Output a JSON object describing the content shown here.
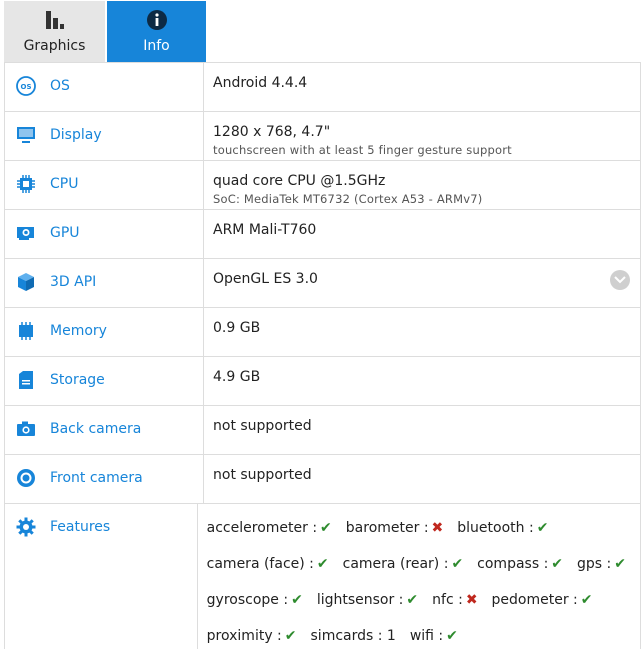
{
  "tabs": [
    {
      "label": "Graphics",
      "icon": "bar-chart-icon",
      "active": false
    },
    {
      "label": "Info",
      "icon": "info-icon",
      "active": true
    }
  ],
  "colors": {
    "accent": "#1785d9",
    "ok": "#2e8b2e",
    "fail": "#c0281e",
    "tab_inactive_bg": "#e6e6e6"
  },
  "rows": [
    {
      "label": "OS",
      "icon": "os-icon",
      "value": "Android 4.4.4",
      "sub": ""
    },
    {
      "label": "Display",
      "icon": "monitor-icon",
      "value": "1280 x 768, 4.7\"",
      "sub": "touchscreen with at least 5 finger gesture support"
    },
    {
      "label": "CPU",
      "icon": "cpu-chip-icon",
      "value": "quad core CPU @1.5GHz",
      "sub": "SoC: MediaTek MT6732 (Cortex A53 - ARMv7)"
    },
    {
      "label": "GPU",
      "icon": "gpu-card-icon",
      "value": "ARM Mali-T760",
      "sub": ""
    },
    {
      "label": "3D API",
      "icon": "cube-icon",
      "value": "OpenGL ES 3.0",
      "sub": "",
      "expandable": true
    },
    {
      "label": "Memory",
      "icon": "memory-icon",
      "value": "0.9 GB",
      "sub": ""
    },
    {
      "label": "Storage",
      "icon": "storage-icon",
      "value": "4.9 GB",
      "sub": ""
    },
    {
      "label": "Back camera",
      "icon": "camera-icon",
      "value": "not supported",
      "sub": ""
    },
    {
      "label": "Front camera",
      "icon": "front-camera-icon",
      "value": "not supported",
      "sub": ""
    }
  ],
  "features": {
    "label": "Features",
    "icon": "gear-icon",
    "lines": [
      [
        {
          "name": "accelerometer :",
          "status": "yes"
        },
        {
          "name": "barometer :",
          "status": "no"
        },
        {
          "name": "bluetooth :",
          "status": "yes"
        }
      ],
      [
        {
          "name": "camera (face) :",
          "status": "yes"
        },
        {
          "name": "camera (rear) :",
          "status": "yes"
        },
        {
          "name": "compass :",
          "status": "yes"
        },
        {
          "name": "gps :",
          "status": "yes"
        }
      ],
      [
        {
          "name": "gyroscope :",
          "status": "yes"
        },
        {
          "name": "lightsensor :",
          "status": "yes"
        },
        {
          "name": "nfc :",
          "status": "no"
        },
        {
          "name": "pedometer :",
          "status": "yes"
        }
      ],
      [
        {
          "name": "proximity :",
          "status": "yes"
        },
        {
          "name": "simcards : 1",
          "status": ""
        },
        {
          "name": "wifi :",
          "status": "yes"
        }
      ]
    ],
    "yes_glyph": "✔",
    "no_glyph": "✖"
  }
}
